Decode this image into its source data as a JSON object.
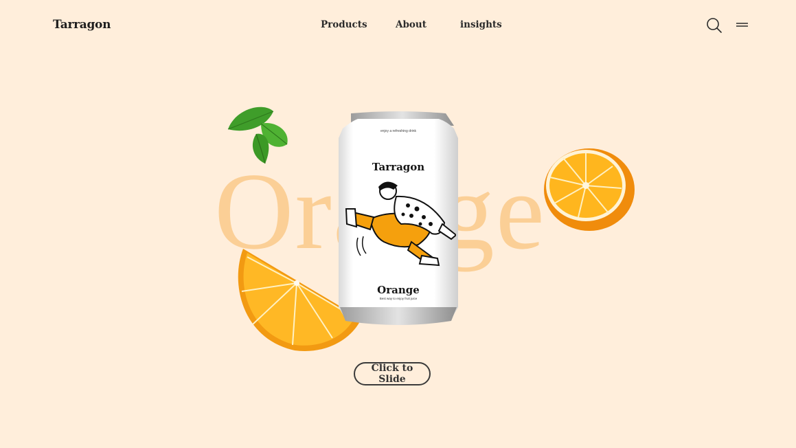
{
  "brand": "Tarragon",
  "nav": {
    "items": [
      {
        "label": "Products"
      },
      {
        "label": "About"
      },
      {
        "label": "insights"
      }
    ]
  },
  "header_icons": [
    "search-icon",
    "menu-icon"
  ],
  "hero": {
    "big_word": "Orange",
    "can": {
      "tagline": "enjoy a refreshing drink",
      "brand": "Tarragon",
      "flavor": "Orange",
      "subtitle": "Best way to enjoy fruit juice"
    },
    "cta_label": "Click to Slide"
  },
  "colors": {
    "background": "#ffeedb",
    "big_word": "#fbcf96",
    "orange": "#f7a21b",
    "leaf": "#4aa52e",
    "text": "#2a2a2a"
  }
}
